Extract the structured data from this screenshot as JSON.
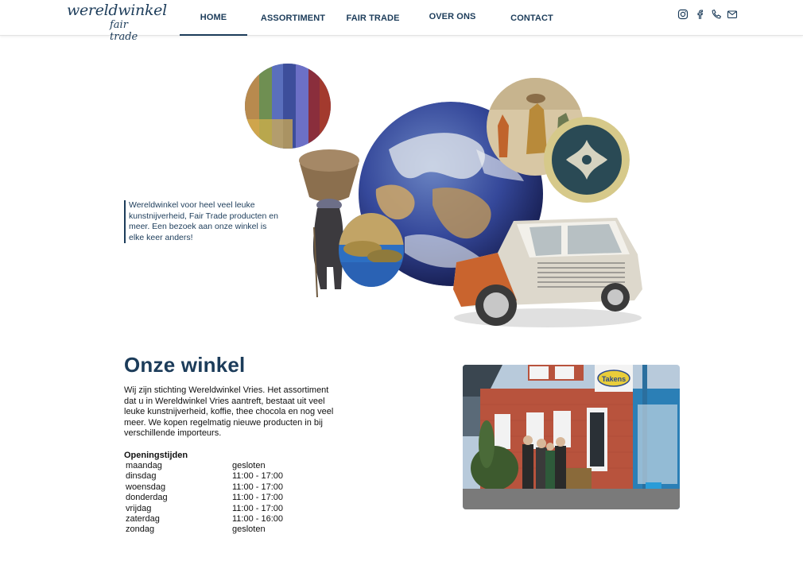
{
  "header": {
    "logo_line1": "wereldwinkel",
    "logo_line2": "fair trade",
    "nav": [
      {
        "label": "HOME",
        "active": true
      },
      {
        "label": "ASSORTIMENT",
        "active": false
      },
      {
        "label": "FAIR TRADE",
        "active": false
      },
      {
        "label": "OVER ONS",
        "active": false
      },
      {
        "label": "CONTACT",
        "active": false
      }
    ],
    "social_icons": [
      "instagram-icon",
      "facebook-icon",
      "phone-icon",
      "mail-icon"
    ]
  },
  "hero": {
    "intro_text": "Wereldwinkel voor heel veel leuke kunstnijverheid, Fair Trade producten en meer. Een bezoek aan onze winkel is elke keer anders!"
  },
  "section": {
    "title": "Onze winkel",
    "description": "Wij zijn stichting Wereldwinkel Vries. Het assortiment dat u in Wereldwinkel Vries aantreft, bestaat uit veel leuke kunstnijverheid, koffie, thee chocola en nog veel meer. We kopen regelmatig nieuwe producten in bij verschillende importeurs.",
    "hours_title": "Openingstijden",
    "hours": [
      {
        "day": "maandag",
        "time": "gesloten"
      },
      {
        "day": "dinsdag",
        "time": "11:00 - 17:00"
      },
      {
        "day": "woensdag",
        "time": "11:00 - 17:00"
      },
      {
        "day": "donderdag",
        "time": "11:00 - 17:00"
      },
      {
        "day": "vrijdag",
        "time": "11:00 - 17:00"
      },
      {
        "day": "zaterdag",
        "time": "11:00 - 16:00"
      },
      {
        "day": "zondag",
        "time": "gesloten"
      }
    ],
    "shop_sign": "Takens"
  },
  "colors": {
    "brand": "#1c3c5a",
    "text": "#111111",
    "background": "#ffffff"
  }
}
